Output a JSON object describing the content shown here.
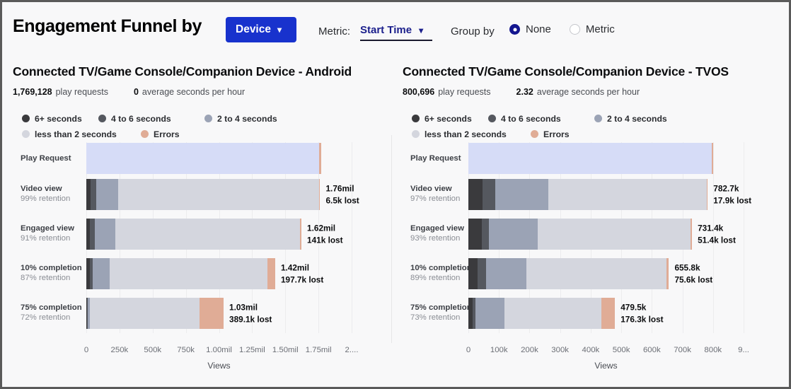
{
  "header": {
    "title": "Engagement Funnel by",
    "device_button": {
      "label": "Device",
      "icon": "chevron-down-icon",
      "color": "#1832cd"
    },
    "metric": {
      "label": "Metric:",
      "value": "Start Time",
      "icon": "chevron-down-icon",
      "color": "#1b1f8c"
    },
    "group_by": {
      "label": "Group by",
      "options": [
        {
          "label": "None",
          "selected": true
        },
        {
          "label": "Metric",
          "selected": false
        }
      ]
    }
  },
  "legend": [
    {
      "label": "6+ seconds",
      "color": "#3a3a3d"
    },
    {
      "label": "4 to 6 seconds",
      "color": "#55585f"
    },
    {
      "label": "2 to 4 seconds",
      "color": "#9ba3b5"
    },
    {
      "label": "less than 2 seconds",
      "color": "#d4d6de"
    },
    {
      "label": "Errors",
      "color": "#e0ac96"
    }
  ],
  "colors": {
    "accent": "#1832cd",
    "link": "#1b1f8c",
    "play_request_bar": "#d6dcf7",
    "errors": "#e0ac96",
    "background": "#f8f8f9"
  },
  "chart_data": [
    {
      "type": "bar",
      "title": "Connected TV/Game Console/Companion Device - Android",
      "play_requests": "1,769,128",
      "play_requests_suffix": "play requests",
      "avg_seconds": "0",
      "avg_seconds_suffix": "average seconds per hour",
      "xlabel": "Views",
      "ylabel": "",
      "xlim": [
        0,
        2000000
      ],
      "ticks": [
        "0",
        "250k",
        "500k",
        "750k",
        "1.00mil",
        "1.25mil",
        "1.50mil",
        "1.75mil",
        "2...."
      ],
      "tick_values": [
        0,
        250000,
        500000,
        750000,
        1000000,
        1250000,
        1500000,
        1750000,
        2000000
      ],
      "grid": true,
      "legend_position": "top",
      "stages": [
        {
          "name": "Play Request",
          "retention": "",
          "value_label": "",
          "lost_label": "",
          "total": 1769128,
          "segments": [
            {
              "series": "Play Request",
              "color": "#d6dcf7",
              "value": 1757000
            },
            {
              "series": "Errors",
              "color": "#e0ac96",
              "value": 12128
            }
          ]
        },
        {
          "name": "Video view",
          "retention": "99% retention",
          "value_label": "1.76mil",
          "lost_label": "6.5k lost",
          "total": 1762600,
          "segments": [
            {
              "series": "6+ seconds",
              "color": "#3a3a3d",
              "value": 30000
            },
            {
              "series": "4 to 6 seconds",
              "color": "#55585f",
              "value": 42000
            },
            {
              "series": "2 to 4 seconds",
              "color": "#9ba3b5",
              "value": 168000
            },
            {
              "series": "less than 2 seconds",
              "color": "#d4d6de",
              "value": 1512600
            },
            {
              "series": "Errors",
              "color": "#e0ac96",
              "value": 10000
            }
          ]
        },
        {
          "name": "Engaged view",
          "retention": "91% retention",
          "value_label": "1.62mil",
          "lost_label": "141k lost",
          "total": 1621600,
          "segments": [
            {
              "series": "6+ seconds",
              "color": "#3a3a3d",
              "value": 27000
            },
            {
              "series": "4 to 6 seconds",
              "color": "#55585f",
              "value": 39000
            },
            {
              "series": "2 to 4 seconds",
              "color": "#9ba3b5",
              "value": 154000
            },
            {
              "series": "less than 2 seconds",
              "color": "#d4d6de",
              "value": 1392600
            },
            {
              "series": "Errors",
              "color": "#e0ac96",
              "value": 9000
            }
          ]
        },
        {
          "name": "10% completion",
          "retention": "87% retention",
          "value_label": "1.42mil",
          "lost_label": "197.7k lost",
          "total": 1423900,
          "segments": [
            {
              "series": "6+ seconds",
              "color": "#3a3a3d",
              "value": 24000
            },
            {
              "series": "4 to 6 seconds",
              "color": "#55585f",
              "value": 22000
            },
            {
              "series": "2 to 4 seconds",
              "color": "#9ba3b5",
              "value": 131000
            },
            {
              "series": "less than 2 seconds",
              "color": "#d4d6de",
              "value": 1186900
            },
            {
              "series": "Errors",
              "color": "#e0ac96",
              "value": 60000
            }
          ]
        },
        {
          "name": "75% completion",
          "retention": "72% retention",
          "value_label": "1.03mil",
          "lost_label": "389.1k lost",
          "total": 1034800,
          "segments": [
            {
              "series": "6+ seconds",
              "color": "#3a3a3d",
              "value": 4000
            },
            {
              "series": "4 to 6 seconds",
              "color": "#55585f",
              "value": 6000
            },
            {
              "series": "2 to 4 seconds",
              "color": "#9ba3b5",
              "value": 14000
            },
            {
              "series": "less than 2 seconds",
              "color": "#d4d6de",
              "value": 830800
            },
            {
              "series": "Errors",
              "color": "#e0ac96",
              "value": 180000
            }
          ]
        }
      ]
    },
    {
      "type": "bar",
      "title": "Connected TV/Game Console/Companion Device - TVOS",
      "play_requests": "800,696",
      "play_requests_suffix": "play requests",
      "avg_seconds": "2.32",
      "avg_seconds_suffix": "average seconds per hour",
      "xlabel": "Views",
      "ylabel": "",
      "xlim": [
        0,
        900000
      ],
      "ticks": [
        "0",
        "100k",
        "200k",
        "300k",
        "400k",
        "500k",
        "600k",
        "700k",
        "800k",
        "9..."
      ],
      "tick_values": [
        0,
        100000,
        200000,
        300000,
        400000,
        500000,
        600000,
        700000,
        800000,
        900000
      ],
      "grid": true,
      "legend_position": "top",
      "stages": [
        {
          "name": "Play Request",
          "retention": "",
          "value_label": "",
          "lost_label": "",
          "total": 800696,
          "segments": [
            {
              "series": "Play Request",
              "color": "#d6dcf7",
              "value": 795000
            },
            {
              "series": "Errors",
              "color": "#e0ac96",
              "value": 5696
            }
          ]
        },
        {
          "name": "Video view",
          "retention": "97% retention",
          "value_label": "782.7k",
          "lost_label": "17.9k lost",
          "total": 782700,
          "segments": [
            {
              "series": "6+ seconds",
              "color": "#3a3a3d",
              "value": 47000
            },
            {
              "series": "4 to 6 seconds",
              "color": "#55585f",
              "value": 42000
            },
            {
              "series": "2 to 4 seconds",
              "color": "#9ba3b5",
              "value": 173000
            },
            {
              "series": "less than 2 seconds",
              "color": "#d4d6de",
              "value": 516700
            },
            {
              "series": "Errors",
              "color": "#e0ac96",
              "value": 4000
            }
          ]
        },
        {
          "name": "Engaged view",
          "retention": "93% retention",
          "value_label": "731.4k",
          "lost_label": "51.4k lost",
          "total": 731400,
          "segments": [
            {
              "series": "6+ seconds",
              "color": "#3a3a3d",
              "value": 45000
            },
            {
              "series": "4 to 6 seconds",
              "color": "#55585f",
              "value": 22000
            },
            {
              "series": "2 to 4 seconds",
              "color": "#9ba3b5",
              "value": 160000
            },
            {
              "series": "less than 2 seconds",
              "color": "#d4d6de",
              "value": 500400
            },
            {
              "series": "Errors",
              "color": "#e0ac96",
              "value": 4000
            }
          ]
        },
        {
          "name": "10% completion",
          "retention": "89% retention",
          "value_label": "655.8k",
          "lost_label": "75.6k lost",
          "total": 655800,
          "segments": [
            {
              "series": "6+ seconds",
              "color": "#3a3a3d",
              "value": 30000
            },
            {
              "series": "4 to 6 seconds",
              "color": "#55585f",
              "value": 28000
            },
            {
              "series": "2 to 4 seconds",
              "color": "#9ba3b5",
              "value": 132000
            },
            {
              "series": "less than 2 seconds",
              "color": "#d4d6de",
              "value": 457800
            },
            {
              "series": "Errors",
              "color": "#e0ac96",
              "value": 8000
            }
          ]
        },
        {
          "name": "75% completion",
          "retention": "73% retention",
          "value_label": "479.5k",
          "lost_label": "176.3k lost",
          "total": 479500,
          "segments": [
            {
              "series": "6+ seconds",
              "color": "#3a3a3d",
              "value": 13000
            },
            {
              "series": "4 to 6 seconds",
              "color": "#55585f",
              "value": 11000
            },
            {
              "series": "2 to 4 seconds",
              "color": "#9ba3b5",
              "value": 95000
            },
            {
              "series": "less than 2 seconds",
              "color": "#d4d6de",
              "value": 315500
            },
            {
              "series": "Errors",
              "color": "#e0ac96",
              "value": 45000
            }
          ]
        }
      ]
    }
  ]
}
